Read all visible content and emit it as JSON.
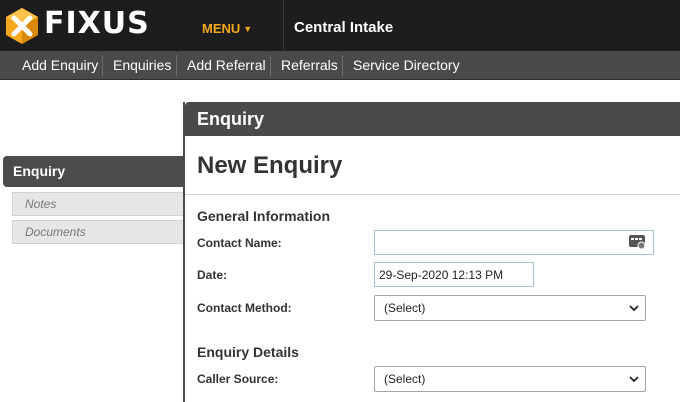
{
  "app": {
    "logo_text": "FIXUS",
    "menu_label": "MENU",
    "page_context": "Central Intake"
  },
  "nav": {
    "items": [
      "Add Enquiry",
      "Enquiries",
      "Add Referral",
      "Referrals",
      "Service Directory"
    ]
  },
  "sidebar": {
    "active": "Enquiry",
    "sub_items": [
      "Notes",
      "Documents"
    ]
  },
  "panel": {
    "header": "Enquiry",
    "title": "New Enquiry",
    "general_section": "General Information",
    "contact_name_label": "Contact Name:",
    "contact_name_value": "",
    "date_label": "Date:",
    "date_value": "29-Sep-2020 12:13 PM",
    "contact_method_label": "Contact Method:",
    "contact_method_value": "(Select)",
    "details_section": "Enquiry Details",
    "caller_source_label": "Caller Source:",
    "caller_source_value": "(Select)"
  },
  "colors": {
    "header_bg": "#1d1d1d",
    "nav_bg": "#4a4a4a",
    "accent_orange": "#f5a81c",
    "input_border": "#a9c1d6"
  },
  "icons": {
    "logo": "fixus-logo-icon",
    "menu_caret": "caret-down-icon",
    "contact_lookup": "contact-card-icon",
    "select_chevron": "chevron-down-icon"
  }
}
